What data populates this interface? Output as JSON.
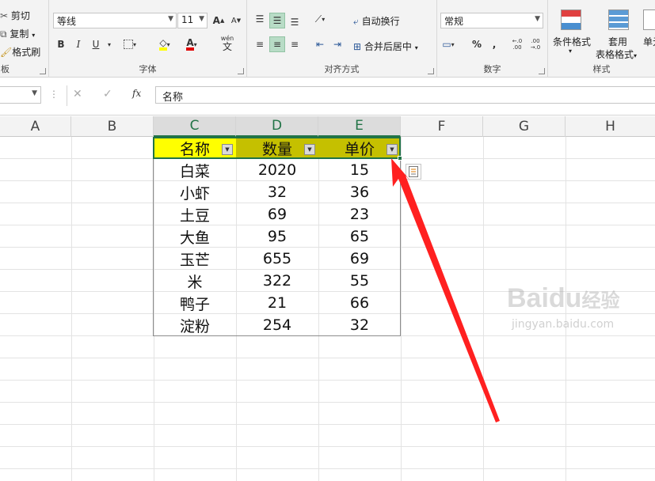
{
  "ribbon": {
    "clipboard": {
      "cut": "剪切",
      "copy": "复制",
      "painter": "格式刷",
      "group": "板"
    },
    "font": {
      "name": "等线",
      "size": "11",
      "group": "字体",
      "bold": "B",
      "italic": "I",
      "underline": "U",
      "grow": "A",
      "shrink": "A",
      "wen": "wén",
      "wen_char": "文"
    },
    "align": {
      "wrap": "自动换行",
      "merge": "合并后居中",
      "group": "对齐方式"
    },
    "number": {
      "format": "常规",
      "group": "数字",
      "percent": "%",
      "comma": ",",
      "inc_dec": "←.0 .00",
      "dec_dec": ".00 →.0"
    },
    "styles": {
      "cond": "条件格式",
      "table1": "套用",
      "table2": "表格格式",
      "cell": "单元",
      "group": "样式"
    }
  },
  "formula_bar": {
    "name_box": "",
    "value": "名称",
    "fx": "fx"
  },
  "columns": [
    "A",
    "B",
    "C",
    "D",
    "E",
    "F",
    "G",
    "H"
  ],
  "table": {
    "headers": [
      "名称",
      "数量",
      "单价"
    ],
    "rows": [
      [
        "白菜",
        "2020",
        "15"
      ],
      [
        "小虾",
        "32",
        "36"
      ],
      [
        "土豆",
        "69",
        "23"
      ],
      [
        "大鱼",
        "95",
        "65"
      ],
      [
        "玉芒",
        "655",
        "69"
      ],
      [
        "米",
        "322",
        "55"
      ],
      [
        "鸭子",
        "21",
        "66"
      ],
      [
        "淀粉",
        "254",
        "32"
      ]
    ]
  },
  "colors": {
    "header_first": "#ffff00",
    "header_other": "#c5c000",
    "arrow": "#ff2020",
    "excel_green": "#217346"
  },
  "watermark": {
    "brand": "Baidu",
    "brand_cn": "经验",
    "url": "jingyan.baidu.com"
  }
}
